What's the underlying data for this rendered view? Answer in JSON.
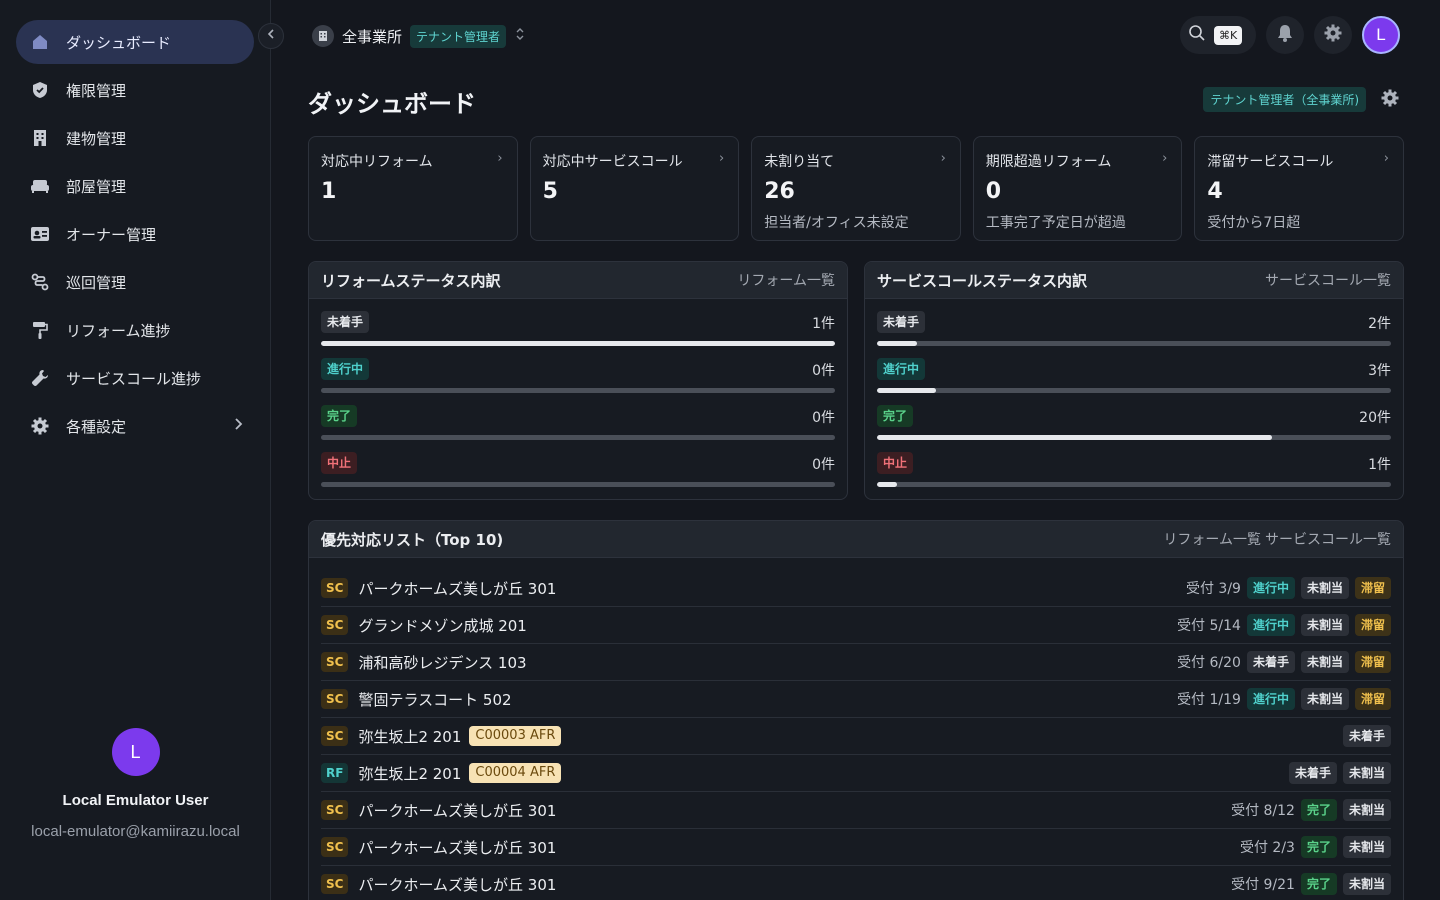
{
  "sidebar": {
    "items": [
      {
        "label": "ダッシュボード",
        "icon": "home-icon",
        "active": true
      },
      {
        "label": "権限管理",
        "icon": "shield-icon"
      },
      {
        "label": "建物管理",
        "icon": "building-icon"
      },
      {
        "label": "部屋管理",
        "icon": "sofa-icon"
      },
      {
        "label": "オーナー管理",
        "icon": "id-card-icon"
      },
      {
        "label": "巡回管理",
        "icon": "route-icon"
      },
      {
        "label": "リフォーム進捗",
        "icon": "paint-roller-icon"
      },
      {
        "label": "サービスコール進捗",
        "icon": "wrench-icon"
      },
      {
        "label": "各種設定",
        "icon": "gear-icon",
        "has_submenu": true
      }
    ],
    "user": {
      "initial": "L",
      "name": "Local Emulator User",
      "email": "local-emulator@kamiirazu.local"
    }
  },
  "topbar": {
    "org_name": "全事業所",
    "role_badge": "テナント管理者",
    "shortcut": "⌘K",
    "avatar_initial": "L"
  },
  "page": {
    "title": "ダッシュボード",
    "role_label": "テナント管理者（全事業所)"
  },
  "stats": [
    {
      "label": "対応中リフォーム",
      "value": "1",
      "sub": ""
    },
    {
      "label": "対応中サービスコール",
      "value": "5",
      "sub": ""
    },
    {
      "label": "未割り当て",
      "value": "26",
      "sub": "担当者/オフィス未設定"
    },
    {
      "label": "期限超過リフォーム",
      "value": "0",
      "sub": "工事完了予定日が超過"
    },
    {
      "label": "滞留サービスコール",
      "value": "4",
      "sub": "受付から7日超"
    }
  ],
  "reform_status": {
    "title": "リフォームステータス内訳",
    "link": "リフォーム一覧",
    "rows": [
      {
        "label": "未着手",
        "count": "1件",
        "fraction": 1.0,
        "style": "gray"
      },
      {
        "label": "進行中",
        "count": "0件",
        "fraction": 0,
        "style": "teal"
      },
      {
        "label": "完了",
        "count": "0件",
        "fraction": 0,
        "style": "green"
      },
      {
        "label": "中止",
        "count": "0件",
        "fraction": 0,
        "style": "red"
      }
    ]
  },
  "service_status": {
    "title": "サービスコールステータス内訳",
    "link": "サービスコール一覧",
    "rows": [
      {
        "label": "未着手",
        "count": "2件",
        "fraction": 0.0769,
        "style": "gray"
      },
      {
        "label": "進行中",
        "count": "3件",
        "fraction": 0.1154,
        "style": "teal"
      },
      {
        "label": "完了",
        "count": "20件",
        "fraction": 0.7692,
        "style": "green"
      },
      {
        "label": "中止",
        "count": "1件",
        "fraction": 0.0385,
        "style": "red"
      }
    ]
  },
  "priority": {
    "title": "優先対応リスト（Top 10)",
    "link_reform": "リフォーム一覧",
    "link_service": "サービスコール一覧",
    "rows": [
      {
        "type": "SC",
        "name": "パークホームズ美しが丘 301",
        "code": "",
        "date": "受付 3/9",
        "badges": [
          {
            "text": "進行中",
            "style": "teal"
          },
          {
            "text": "未割当",
            "style": "gray"
          },
          {
            "text": "滞留",
            "style": "amber"
          }
        ]
      },
      {
        "type": "SC",
        "name": "グランドメゾン成城 201",
        "code": "",
        "date": "受付 5/14",
        "badges": [
          {
            "text": "進行中",
            "style": "teal"
          },
          {
            "text": "未割当",
            "style": "gray"
          },
          {
            "text": "滞留",
            "style": "amber"
          }
        ]
      },
      {
        "type": "SC",
        "name": "浦和高砂レジデンス 103",
        "code": "",
        "date": "受付 6/20",
        "badges": [
          {
            "text": "未着手",
            "style": "gray"
          },
          {
            "text": "未割当",
            "style": "gray"
          },
          {
            "text": "滞留",
            "style": "amber"
          }
        ]
      },
      {
        "type": "SC",
        "name": "警固テラスコート 502",
        "code": "",
        "date": "受付 1/19",
        "badges": [
          {
            "text": "進行中",
            "style": "teal"
          },
          {
            "text": "未割当",
            "style": "gray"
          },
          {
            "text": "滞留",
            "style": "amber"
          }
        ]
      },
      {
        "type": "SC",
        "name": "弥生坂上2 201",
        "code": "C00003 AFR",
        "date": "",
        "badges": [
          {
            "text": "未着手",
            "style": "gray"
          }
        ]
      },
      {
        "type": "RF",
        "name": "弥生坂上2 201",
        "code": "C00004 AFR",
        "date": "",
        "badges": [
          {
            "text": "未着手",
            "style": "gray"
          },
          {
            "text": "未割当",
            "style": "gray"
          }
        ]
      },
      {
        "type": "SC",
        "name": "パークホームズ美しが丘 301",
        "code": "",
        "date": "受付 8/12",
        "badges": [
          {
            "text": "完了",
            "style": "green"
          },
          {
            "text": "未割当",
            "style": "gray"
          }
        ]
      },
      {
        "type": "SC",
        "name": "パークホームズ美しが丘 301",
        "code": "",
        "date": "受付 2/3",
        "badges": [
          {
            "text": "完了",
            "style": "green"
          },
          {
            "text": "未割当",
            "style": "gray"
          }
        ]
      },
      {
        "type": "SC",
        "name": "パークホームズ美しが丘 301",
        "code": "",
        "date": "受付 9/21",
        "badges": [
          {
            "text": "完了",
            "style": "green"
          },
          {
            "text": "未割当",
            "style": "gray"
          }
        ]
      }
    ]
  },
  "colors": {
    "accent": "#7c3aed",
    "active_nav": "#2a3352",
    "teal": "#4fd1cc",
    "green": "#5ad28a",
    "red": "#f07178",
    "amber": "#f0c04d"
  }
}
